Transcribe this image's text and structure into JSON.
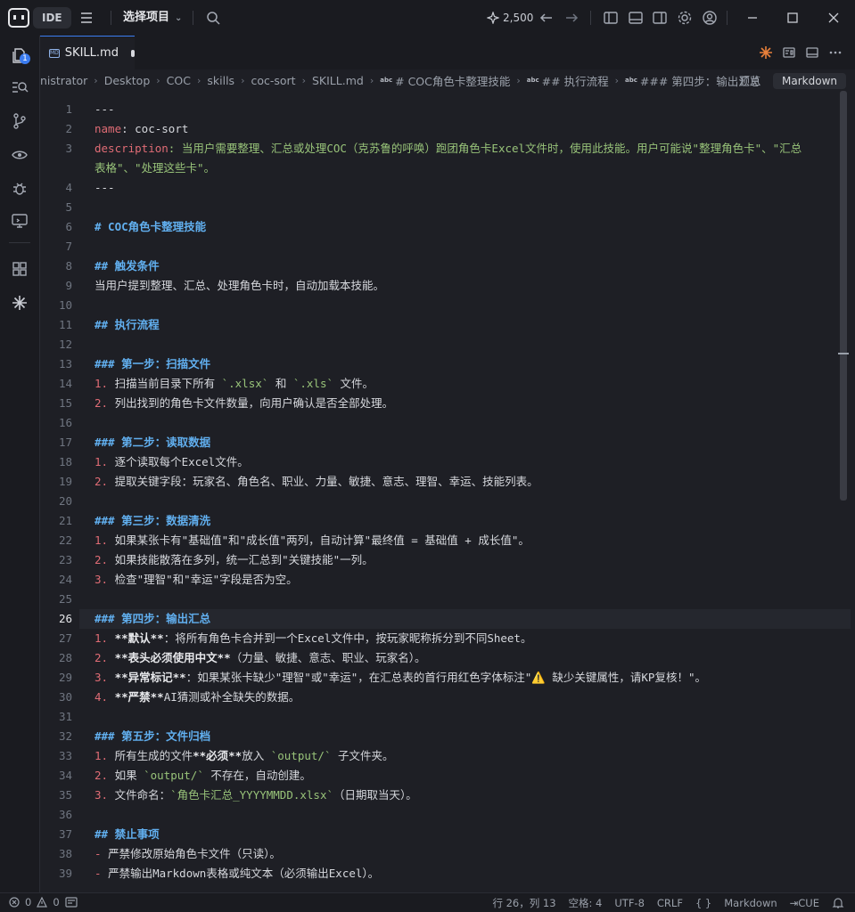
{
  "titlebar": {
    "ide_label": "IDE",
    "project_label": "选择项目",
    "credits": "2,500"
  },
  "activity_badge": "1",
  "tab": {
    "label": "SKILL.md",
    "icon_text": "MD"
  },
  "breadcrumbs": [
    {
      "label": "nistrator"
    },
    {
      "label": "Desktop"
    },
    {
      "label": "COC"
    },
    {
      "label": "skills"
    },
    {
      "label": "coc-sort"
    },
    {
      "label": "SKILL.md"
    },
    {
      "label": "# COC角色卡整理技能"
    },
    {
      "label": "## 执行流程"
    },
    {
      "label": "### 第四步：输出汇总"
    }
  ],
  "breadcrumb_right": {
    "preview": "预览",
    "markdown": "Markdown"
  },
  "editor": {
    "active_line": 26,
    "lines": [
      {
        "n": "1",
        "parts": [
          {
            "t": "---",
            "c": ""
          }
        ]
      },
      {
        "n": "2",
        "parts": [
          {
            "t": "name",
            "c": "k"
          },
          {
            "t": ": coc-sort",
            "c": ""
          }
        ]
      },
      {
        "n": "3",
        "parts": [
          {
            "t": "description",
            "c": "k"
          },
          {
            "t": ": 当用户需要整理、汇总或处理COC（克苏鲁的呼唤）跑团角色卡Excel文件时，使用此技能。用户可能说\"整理角色卡\"、\"汇总",
            "c": "v"
          }
        ]
      },
      {
        "n": "",
        "parts": [
          {
            "t": "表格\"、\"处理这些卡\"。",
            "c": "v"
          }
        ]
      },
      {
        "n": "4",
        "parts": [
          {
            "t": "---",
            "c": ""
          }
        ]
      },
      {
        "n": "5",
        "parts": []
      },
      {
        "n": "6",
        "parts": [
          {
            "t": "# COC角色卡整理技能",
            "c": "h"
          }
        ]
      },
      {
        "n": "7",
        "parts": []
      },
      {
        "n": "8",
        "parts": [
          {
            "t": "## 触发条件",
            "c": "h"
          }
        ]
      },
      {
        "n": "9",
        "parts": [
          {
            "t": "当用户提到整理、汇总、处理角色卡时，自动加载本技能。",
            "c": ""
          }
        ]
      },
      {
        "n": "10",
        "parts": []
      },
      {
        "n": "11",
        "parts": [
          {
            "t": "## 执行流程",
            "c": "h"
          }
        ]
      },
      {
        "n": "12",
        "parts": []
      },
      {
        "n": "13",
        "parts": [
          {
            "t": "### 第一步：扫描文件",
            "c": "h"
          }
        ]
      },
      {
        "n": "14",
        "parts": [
          {
            "t": "1. ",
            "c": "n"
          },
          {
            "t": "扫描当前目录下所有 ",
            "c": ""
          },
          {
            "t": "`.xlsx`",
            "c": "c"
          },
          {
            "t": " 和 ",
            "c": ""
          },
          {
            "t": "`.xls`",
            "c": "c"
          },
          {
            "t": " 文件。",
            "c": ""
          }
        ]
      },
      {
        "n": "15",
        "parts": [
          {
            "t": "2. ",
            "c": "n"
          },
          {
            "t": "列出找到的角色卡文件数量，向用户确认是否全部处理。",
            "c": ""
          }
        ]
      },
      {
        "n": "16",
        "parts": []
      },
      {
        "n": "17",
        "parts": [
          {
            "t": "### 第二步：读取数据",
            "c": "h"
          }
        ]
      },
      {
        "n": "18",
        "parts": [
          {
            "t": "1. ",
            "c": "n"
          },
          {
            "t": "逐个读取每个Excel文件。",
            "c": ""
          }
        ]
      },
      {
        "n": "19",
        "parts": [
          {
            "t": "2. ",
            "c": "n"
          },
          {
            "t": "提取关键字段：玩家名、角色名、职业、力量、敏捷、意志、理智、幸运、技能列表。",
            "c": ""
          }
        ]
      },
      {
        "n": "20",
        "parts": []
      },
      {
        "n": "21",
        "parts": [
          {
            "t": "### 第三步：数据清洗",
            "c": "h"
          }
        ]
      },
      {
        "n": "22",
        "parts": [
          {
            "t": "1. ",
            "c": "n"
          },
          {
            "t": "如果某张卡有\"基础值\"和\"成长值\"两列，自动计算\"最终值 = 基础值 + 成长值\"。",
            "c": ""
          }
        ]
      },
      {
        "n": "23",
        "parts": [
          {
            "t": "2. ",
            "c": "n"
          },
          {
            "t": "如果技能散落在多列，统一汇总到\"关键技能\"一列。",
            "c": ""
          }
        ]
      },
      {
        "n": "24",
        "parts": [
          {
            "t": "3. ",
            "c": "n"
          },
          {
            "t": "检查\"理智\"和\"幸运\"字段是否为空。",
            "c": ""
          }
        ]
      },
      {
        "n": "25",
        "parts": []
      },
      {
        "n": "26",
        "parts": [
          {
            "t": "### 第四步：输出汇总",
            "c": "h"
          }
        ]
      },
      {
        "n": "27",
        "parts": [
          {
            "t": "1. ",
            "c": "n"
          },
          {
            "t": "**默认**",
            "c": "b"
          },
          {
            "t": "：将所有角色卡合并到一个Excel文件中，按玩家昵称拆分到不同Sheet。",
            "c": ""
          }
        ]
      },
      {
        "n": "28",
        "parts": [
          {
            "t": "2. ",
            "c": "n"
          },
          {
            "t": "**表头必须使用中文**",
            "c": "b"
          },
          {
            "t": "（力量、敏捷、意志、职业、玩家名）。",
            "c": ""
          }
        ]
      },
      {
        "n": "29",
        "parts": [
          {
            "t": "3. ",
            "c": "n"
          },
          {
            "t": "**异常标记**",
            "c": "b"
          },
          {
            "t": "：如果某张卡缺少\"理智\"或\"幸运\"，在汇总表的首行用红色字体标注\"⚠️ 缺少关键属性，请KP复核！\"。",
            "c": ""
          }
        ]
      },
      {
        "n": "30",
        "parts": [
          {
            "t": "4. ",
            "c": "n"
          },
          {
            "t": "**严禁**",
            "c": "b"
          },
          {
            "t": "AI猜测或补全缺失的数据。",
            "c": ""
          }
        ]
      },
      {
        "n": "31",
        "parts": []
      },
      {
        "n": "32",
        "parts": [
          {
            "t": "### 第五步：文件归档",
            "c": "h"
          }
        ]
      },
      {
        "n": "33",
        "parts": [
          {
            "t": "1. ",
            "c": "n"
          },
          {
            "t": "所有生成的文件",
            "c": ""
          },
          {
            "t": "**必须**",
            "c": "b"
          },
          {
            "t": "放入 ",
            "c": ""
          },
          {
            "t": "`output/`",
            "c": "c"
          },
          {
            "t": " 子文件夹。",
            "c": ""
          }
        ]
      },
      {
        "n": "34",
        "parts": [
          {
            "t": "2. ",
            "c": "n"
          },
          {
            "t": "如果 ",
            "c": ""
          },
          {
            "t": "`output/`",
            "c": "c"
          },
          {
            "t": " 不存在，自动创建。",
            "c": ""
          }
        ]
      },
      {
        "n": "35",
        "parts": [
          {
            "t": "3. ",
            "c": "n"
          },
          {
            "t": "文件命名：",
            "c": ""
          },
          {
            "t": "`角色卡汇总_YYYYMMDD.xlsx`",
            "c": "c"
          },
          {
            "t": "（日期取当天）。",
            "c": ""
          }
        ]
      },
      {
        "n": "36",
        "parts": []
      },
      {
        "n": "37",
        "parts": [
          {
            "t": "## 禁止事项",
            "c": "h"
          }
        ]
      },
      {
        "n": "38",
        "parts": [
          {
            "t": "- ",
            "c": "n"
          },
          {
            "t": "严禁修改原始角色卡文件（只读）。",
            "c": ""
          }
        ]
      },
      {
        "n": "39",
        "parts": [
          {
            "t": "- ",
            "c": "n"
          },
          {
            "t": "严禁输出Markdown表格或纯文本（必须输出Excel）。",
            "c": ""
          }
        ]
      }
    ]
  },
  "statusbar": {
    "errors": "0",
    "warnings": "0",
    "position": "行 26，列 13",
    "spaces": "空格: 4",
    "encoding": "UTF-8",
    "eol": "CRLF",
    "braces": "{ }",
    "language": "Markdown",
    "cue": "CUE"
  }
}
